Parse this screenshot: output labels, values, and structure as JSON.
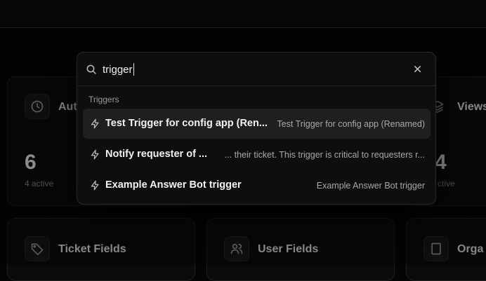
{
  "background": {
    "cards_row1": [
      {
        "title": "Aut",
        "value": "6",
        "sub": "4 active",
        "icon": "clock-icon"
      },
      {
        "title": "Views",
        "value": "4",
        "sub": "ctive",
        "icon": "layers-icon"
      }
    ],
    "cards_row2": [
      {
        "title": "Ticket Fields",
        "icon": "tag-icon"
      },
      {
        "title": "User Fields",
        "icon": "users-icon"
      },
      {
        "title": "Orga",
        "icon": "building-icon"
      }
    ]
  },
  "search": {
    "query": "trigger",
    "placeholder": ""
  },
  "results_group": {
    "label": "Triggers",
    "items": [
      {
        "title": "Test Trigger for config app (Ren...",
        "desc": "Test Trigger for config app (Renamed)",
        "icon": "lightning-icon",
        "active": true
      },
      {
        "title": "Notify requester of ...",
        "desc": "... their ticket. This trigger is critical to requesters r...",
        "icon": "lightning-icon",
        "active": false
      },
      {
        "title": "Example Answer Bot trigger",
        "desc": "Example Answer Bot trigger",
        "icon": "lightning-icon",
        "active": false
      }
    ]
  },
  "colors": {
    "background": "#050505",
    "palette_bg": "#0e0e0e",
    "active_row": "#1f1f1f"
  }
}
